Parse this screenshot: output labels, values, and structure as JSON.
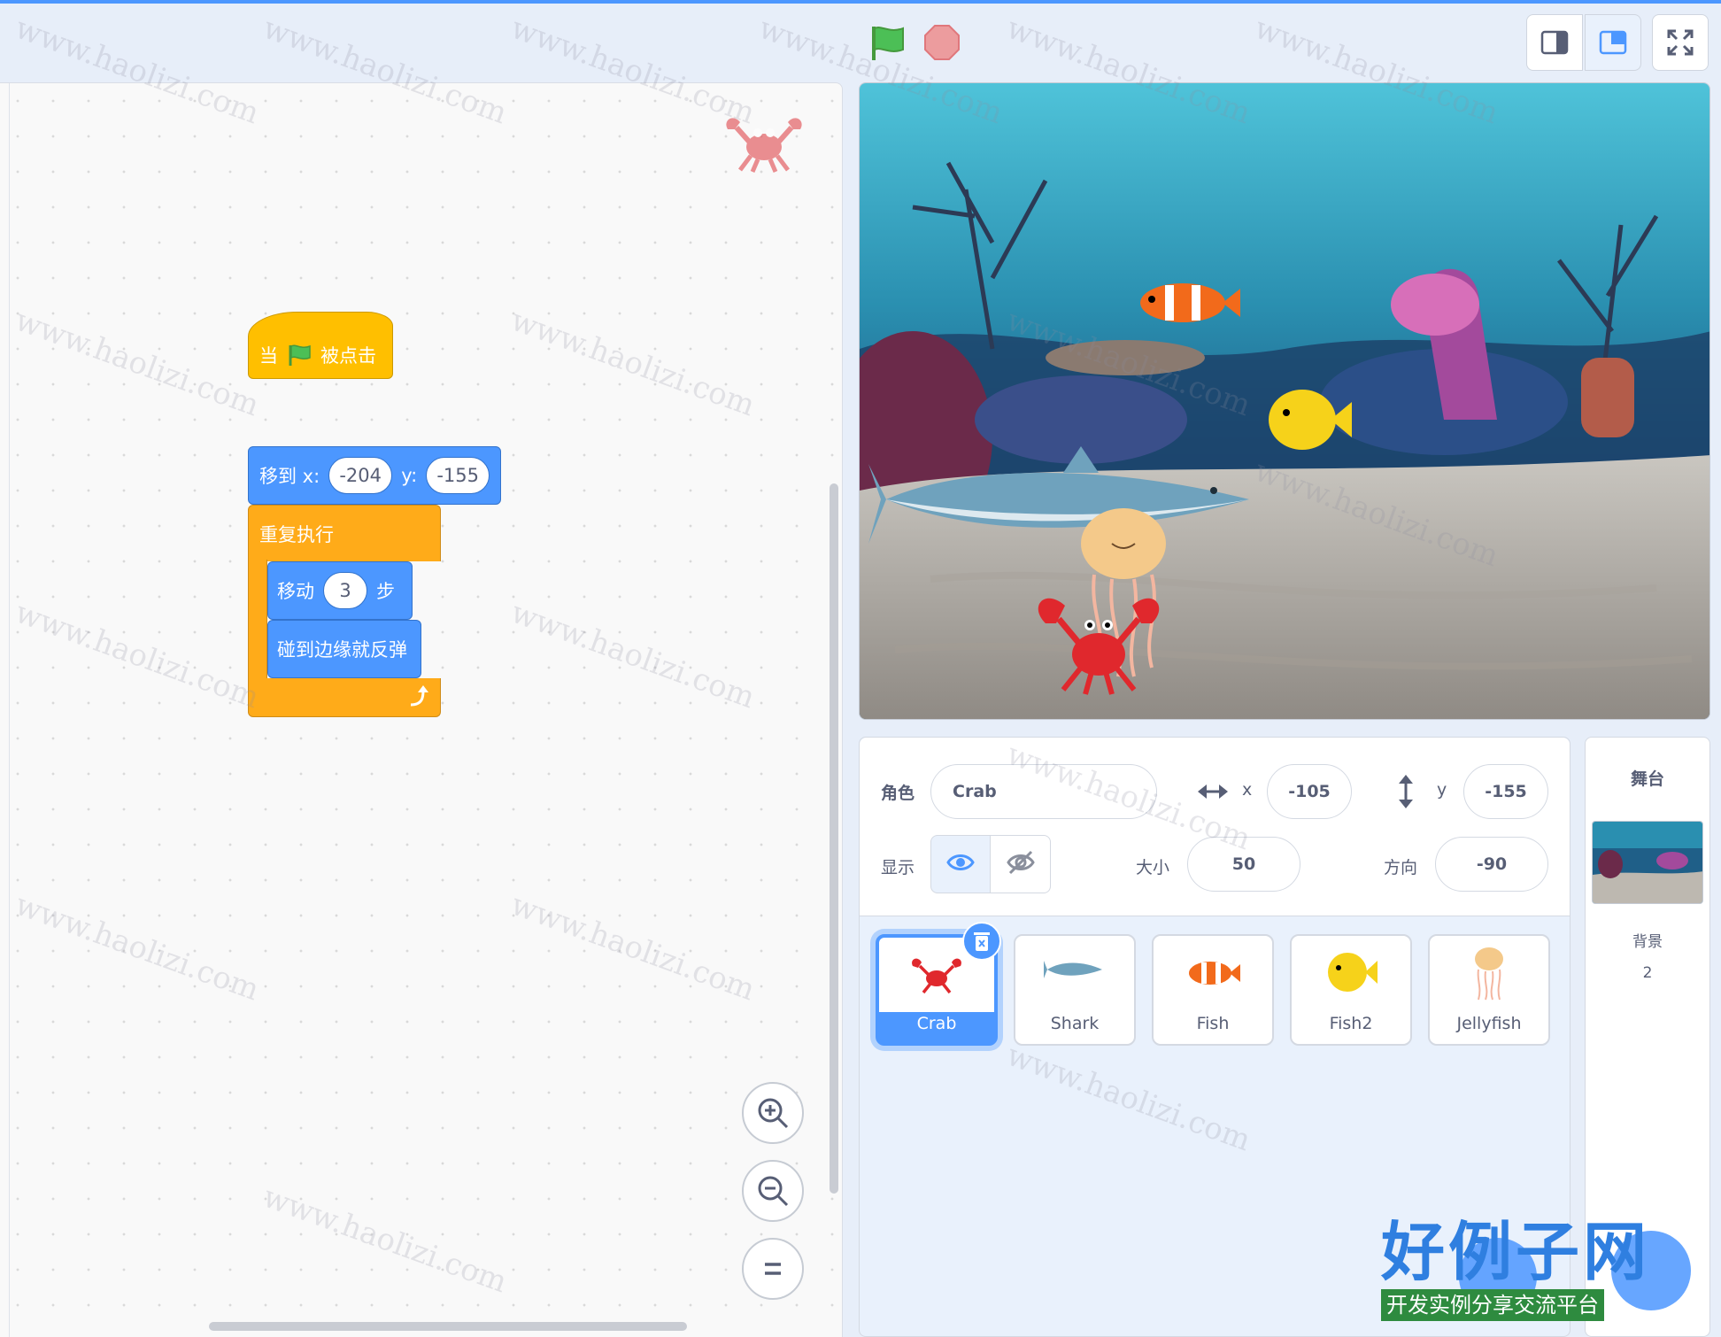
{
  "code": {
    "when_prefix": "当",
    "when_suffix": "被点击",
    "goto_label": "移到 x:",
    "goto_x": "-204",
    "goto_y_label": "y:",
    "goto_y": "-155",
    "forever_label": "重复执行",
    "move_label": "移动",
    "move_steps": "3",
    "move_unit": "步",
    "bounce_label": "碰到边缘就反弹"
  },
  "sprite_info": {
    "sprite_label": "角色",
    "sprite_name": "Crab",
    "x_label": "x",
    "x_value": "-105",
    "y_label": "y",
    "y_value": "-155",
    "show_label": "显示",
    "size_label": "大小",
    "size_value": "50",
    "direction_label": "方向",
    "direction_value": "-90"
  },
  "sprites": [
    {
      "name": "Crab",
      "selected": true
    },
    {
      "name": "Shark",
      "selected": false
    },
    {
      "name": "Fish",
      "selected": false
    },
    {
      "name": "Fish2",
      "selected": false
    },
    {
      "name": "Jellyfish",
      "selected": false
    }
  ],
  "stage_panel": {
    "title": "舞台",
    "backdrop_label": "背景",
    "backdrop_count": "2"
  },
  "watermark": {
    "site_text": "www.haolizi.com",
    "logo_title": "好例子网",
    "logo_subtitle": "开发实例分享交流平台"
  },
  "colors": {
    "accent": "#4c97ff",
    "event": "#ffbf00",
    "control": "#ffab19",
    "motion": "#4c97ff"
  },
  "icons": [
    "green-flag-icon",
    "stop-icon",
    "small-stage-icon",
    "large-stage-icon",
    "fullscreen-icon",
    "zoom-in-icon",
    "zoom-out-icon",
    "zoom-reset-icon",
    "eye-icon",
    "eye-off-icon",
    "trash-icon",
    "arrow-horizontal-icon",
    "arrow-vertical-icon"
  ]
}
